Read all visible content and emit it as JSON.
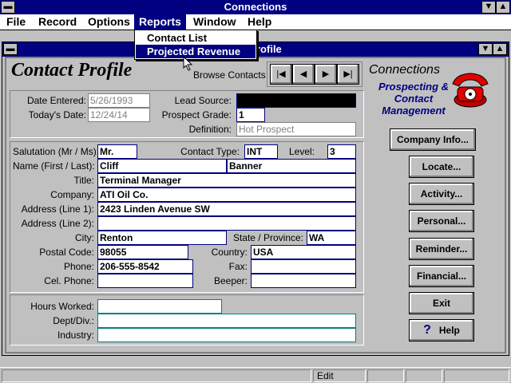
{
  "app": {
    "title": "Connections"
  },
  "menu": {
    "items": [
      {
        "label": "File"
      },
      {
        "label": "Record"
      },
      {
        "label": "Options"
      },
      {
        "label": "Reports"
      },
      {
        "label": "Window"
      },
      {
        "label": "Help"
      }
    ],
    "reports_dropdown": [
      {
        "label": "Contact List"
      },
      {
        "label": "Projected Revenue"
      }
    ]
  },
  "child": {
    "title": "Contact Profile",
    "title_visible_fragment": "rofile"
  },
  "header": {
    "title": "Contact Profile",
    "browse_label": "Browse Contacts",
    "nav": [
      "|◀",
      "◀",
      "▶",
      "▶|"
    ]
  },
  "brand": {
    "name": "Connections",
    "tagline_1": "Prospecting &",
    "tagline_2": "Contact",
    "tagline_3": "Management"
  },
  "top_panel": {
    "date_entered_label": "Date Entered:",
    "date_entered": "5/26/1993",
    "todays_date_label": "Today's Date:",
    "todays_date": "12/24/14",
    "lead_source_label": "Lead Source:",
    "lead_source": "",
    "prospect_grade_label": "Prospect Grade:",
    "prospect_grade": "1",
    "definition_label": "Definition:",
    "definition": "Hot Prospect"
  },
  "contact": {
    "salutation_label": "Salutation (Mr / Ms):",
    "salutation": "Mr.",
    "contact_type_label": "Contact Type:",
    "contact_type": "INT",
    "level_label": "Level:",
    "level": "3",
    "name_label": "Name (First / Last):",
    "first_name": "Cliff",
    "last_name": "Banner",
    "title_label": "Title:",
    "title": "Terminal Manager",
    "company_label": "Company:",
    "company": "ATI Oil Co.",
    "address1_label": "Address (Line 1):",
    "address1": "2423 Linden Avenue SW",
    "address2_label": "Address (Line 2):",
    "address2": "",
    "city_label": "City:",
    "city": "Renton",
    "state_label": "State / Province:",
    "state": "WA",
    "postal_label": "Postal Code:",
    "postal": "98055",
    "country_label": "Country:",
    "country": "USA",
    "phone_label": "Phone:",
    "phone": "206-555-8542",
    "fax_label": "Fax:",
    "fax": "",
    "cel_label": "Cel. Phone:",
    "cel": "",
    "beeper_label": "Beeper:",
    "beeper": ""
  },
  "bottom_panel": {
    "hours_label": "Hours Worked:",
    "hours": "",
    "dept_label": "Dept/Div.:",
    "dept": "",
    "industry_label": "Industry:",
    "industry": ""
  },
  "buttons": {
    "company_info": "Company Info...",
    "locate": "Locate...",
    "activity": "Activity...",
    "personal": "Personal...",
    "reminder": "Reminder...",
    "financial": "Financial...",
    "exit": "Exit",
    "help": "Help"
  },
  "status": {
    "mode": "Edit"
  },
  "colors": {
    "titlebar": "#000080",
    "face": "#c0c0c0",
    "accent_text": "#000080"
  }
}
